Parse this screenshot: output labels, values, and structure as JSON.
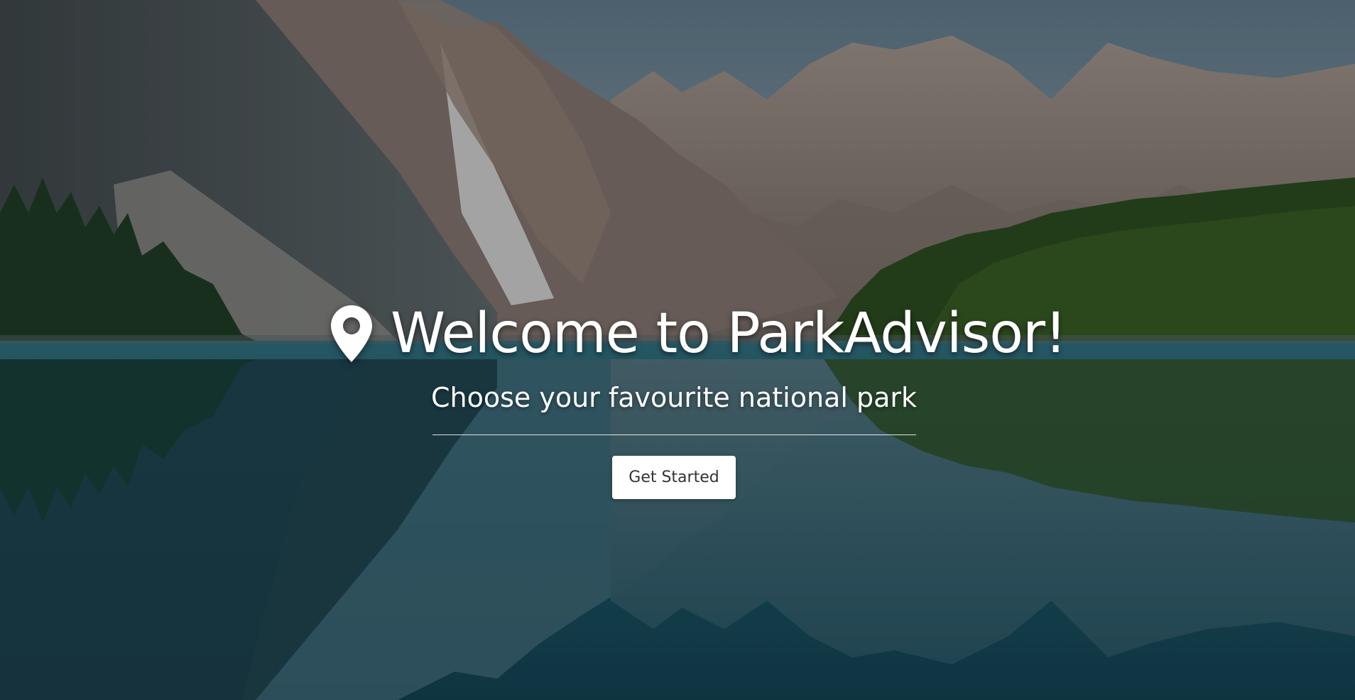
{
  "hero": {
    "title": "Welcome to ParkAdvisor!",
    "subtitle": "Choose your favourite national park",
    "cta_label": "Get Started",
    "icon": "map-marker-icon",
    "background": "mountain-lake-reflection-photo"
  },
  "colors": {
    "text": "#ffffff",
    "button_bg": "#ffffff",
    "button_text": "#333333"
  }
}
